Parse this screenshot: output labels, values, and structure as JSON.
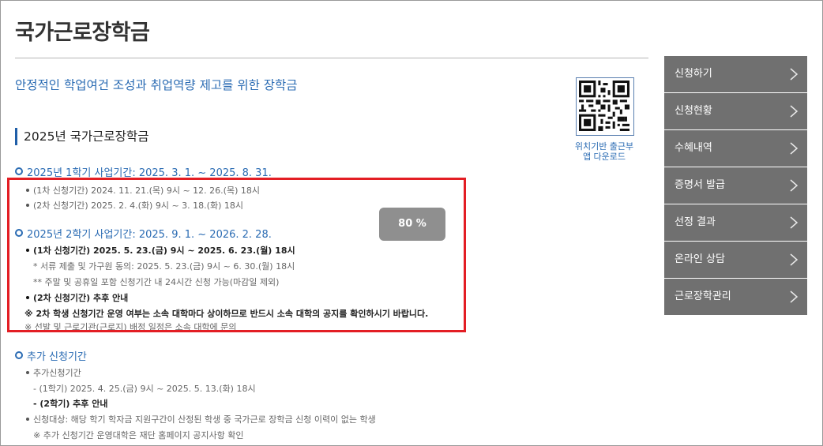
{
  "page": {
    "title": "국가근로장학금",
    "subtitle": "안정적인 학업여건 조성과 취업역량 제고를 위한 장학금"
  },
  "section": {
    "heading": "2025년 국가근로장학금"
  },
  "qr": {
    "caption_line1": "위치기반 출근부",
    "caption_line2": "앱 다운로드"
  },
  "semester1": {
    "heading": "2025년 1학기 사업기간: 2025. 3. 1. ~ 2025. 8. 31.",
    "lines": [
      "(1차 신청기간) 2024. 11. 21.(목) 9시 ~ 12. 26.(목) 18시",
      "(2차 신청기간) 2025. 2. 4.(화) 9시 ~ 3. 18.(화) 18시"
    ]
  },
  "semester2": {
    "heading": "2025년 2학기 사업기간: 2025. 9. 1. ~ 2026. 2. 28.",
    "first_period": "(1차 신청기간) 2025. 5. 23.(금) 9시 ~ 2025. 6. 23.(월) 18시",
    "note_documents": "* 서류 제출 및 가구원 동의: 2025. 5. 23.(금) 9시 ~ 6. 30.(월) 18시",
    "note_holidays": "** 주말 및 공휴일 포함 신청기간 내 24시간 신청 가능(마감일 제외)",
    "second_period": "(2차 신청기간) 추후 안내",
    "notice": "※ 2차 학생 신청기간 운영 여부는 소속 대학마다 상이하므로 반드시 소속 대학의 공지를 확인하시기 바랍니다.",
    "notice_sub": "※ 선발 및 근로기관(근로지) 배정 일정은 소속 대학에 문의"
  },
  "zoom": {
    "label": "80 %"
  },
  "additional": {
    "heading": "추가 신청기간",
    "item1": "추가신청기간",
    "item1_sub1": "- (1학기) 2025. 4. 25.(금) 9시 ~ 2025. 5. 13.(화) 18시",
    "item1_sub2": "- (2학기) 추후 안내",
    "item2": "신청대상: 해당 학기 학자금 지원구간이 산정된 학생 중 국가근로 장학금 신청 이력이 없는 학생",
    "item2_note": "※ 추가 신청기간 운영대학은 재단 홈페이지 공지사항 확인"
  },
  "sidebar": {
    "items": [
      {
        "label": "신청하기"
      },
      {
        "label": "신청현황"
      },
      {
        "label": "수혜내역"
      },
      {
        "label": "증명서 발급"
      },
      {
        "label": "선정 결과"
      },
      {
        "label": "온라인 상담"
      },
      {
        "label": "근로장학관리"
      }
    ],
    "chevron_icon": "chevron-right-icon"
  },
  "colors": {
    "accent_blue": "#2a6bb3",
    "highlight_red": "#e31e24",
    "sidebar_gray": "#707070",
    "zoom_badge_gray": "#8f8f8f"
  }
}
